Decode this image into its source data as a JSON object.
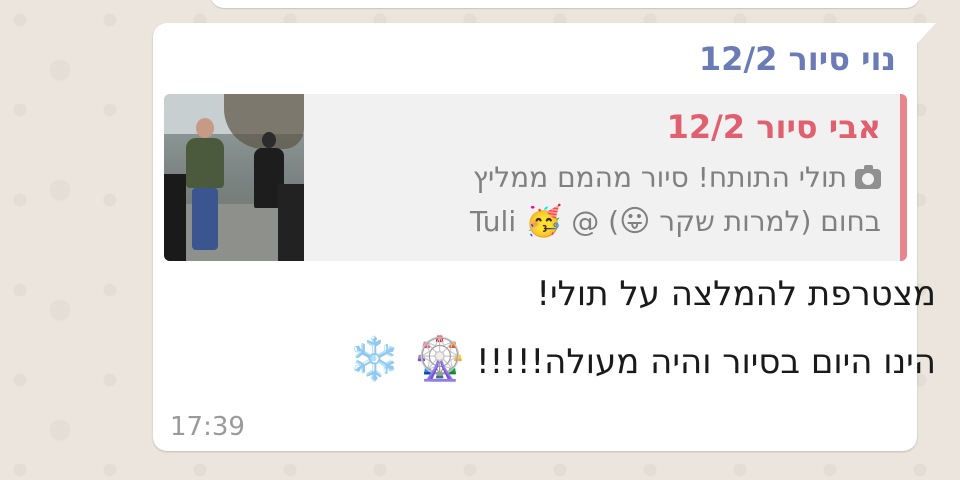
{
  "message": {
    "sender": "נוי סיור 12/2",
    "quoted": {
      "author": "אבי סיור 12/2",
      "media_icon": "camera-icon",
      "text_line1": "תולי התותח! סיור מהמם ממליץ",
      "text_line2_prefix": "בחום (למרות שקר",
      "text_line2_emoji": "😛",
      "text_line2_mid": ") @",
      "text_line2_emoji2": "🥳",
      "text_line2_suffix": "Tuli"
    },
    "body_line1": "מצטרפת להמלצה על תולי!",
    "body_line2": "הינו היום בסיור והיה מעולה!!!!!",
    "body_emojis": "🎡 ❄️",
    "time": "17:39"
  },
  "colors": {
    "sender": "#6b7bb5",
    "quote_author": "#e0606f",
    "quote_bar": "#e8858e",
    "bubble": "#ffffff",
    "background": "#ece5dd"
  }
}
